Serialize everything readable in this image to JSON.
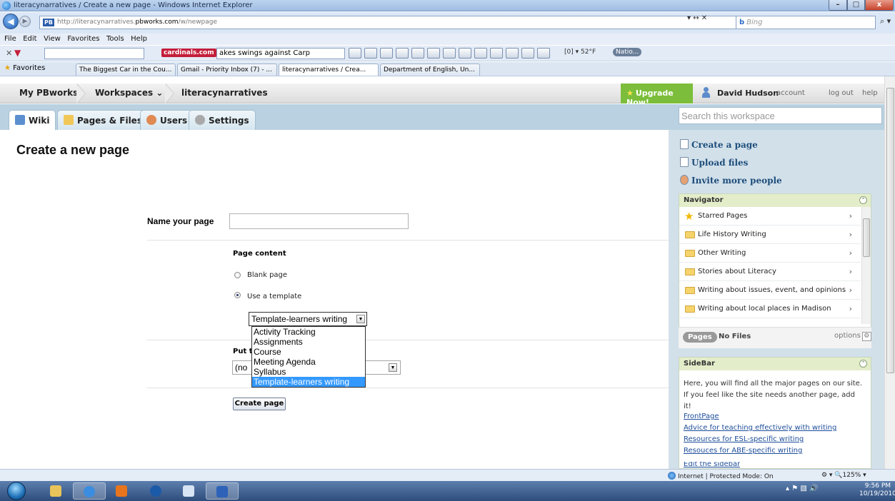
{
  "window": {
    "title": "literacynarratives / Create a new page - Windows Internet Explorer",
    "min": "–",
    "max": "□",
    "close": "x"
  },
  "address": {
    "prefix": "PB",
    "url_dim": "http://literacynarratives.",
    "url_bold": "pbworks.com",
    "url_tail": "/w/newpage",
    "tools": "▾  ↔  ✕",
    "search_placeholder": "Bing",
    "search_go": "⌕ ▾"
  },
  "menu": [
    "File",
    "Edit",
    "View",
    "Favorites",
    "Tools",
    "Help"
  ],
  "toolbar": {
    "cardinals": "cardinals.com",
    "ticker": "akes swings against Carp",
    "weather": "[0]  ▾  52°F",
    "natio": "Natio..."
  },
  "favorites": {
    "label": "Favorites",
    "tabs": [
      "The Biggest Car in the Cou...",
      "Gmail - Priority Inbox (7) - ...",
      "literacynarratives / Crea...",
      "Department of English, Un..."
    ]
  },
  "pbheader": {
    "my_pbworks": "My PBworks",
    "workspaces": "Workspaces ⌄",
    "site": "literacynarratives",
    "upgrade": "Upgrade Now!",
    "user": "David Hudson",
    "account": "account",
    "logout": "log out",
    "help": "help"
  },
  "tabs": {
    "wiki": "Wiki",
    "pages_files": "Pages & Files",
    "users": "Users",
    "settings": "Settings"
  },
  "search_workspace": "Search this workspace",
  "page": {
    "title": "Create a new page",
    "name_label": "Name your page",
    "name_value": "",
    "content_label": "Page content",
    "blank_page": "Blank page",
    "use_template": "Use a template",
    "template_selected": "Template-learners writing",
    "template_options": [
      "Activity Tracking",
      "Assignments",
      "Course",
      "Meeting Agenda",
      "Syllabus",
      "Template-learners writing"
    ],
    "put_label": "Put th",
    "folder_value": "(no",
    "create_button": "Create page"
  },
  "sidebar": {
    "create_page": "Create a page",
    "upload_files": "Upload files",
    "invite": "Invite more people",
    "navigator_title": "Navigator",
    "nav_items": [
      "Starred Pages",
      "Life History Writing",
      "Other Writing",
      "Stories about Literacy",
      "Writing about issues, event, and opinions",
      "Writing about local places in Madison"
    ],
    "pages_pill": "Pages",
    "no_files": "No Files",
    "options": "options",
    "sidebar_title": "SideBar",
    "sidebar_text": "Here, you will find all the major pages on our site.  If you feel like the site needs another page, add it!",
    "links": [
      "FrontPage",
      "Advice for teaching effectively with writing",
      "Resources for ESL-specific writing",
      "Resouces for ABE-specific writing",
      "Edit the sidebar"
    ]
  },
  "status": {
    "zone": "Internet | Protected Mode: On",
    "zoom": "⚙ ▾   🔍125%  ▾"
  },
  "clock": {
    "time": "9:56 PM",
    "date": "10/19/2010"
  },
  "colors": {
    "upgrade_green": "#7cbe3b",
    "tab_blue": "#b9d1e1",
    "sidebar_bg": "#d2e0ea",
    "selection": "#3399ff"
  }
}
